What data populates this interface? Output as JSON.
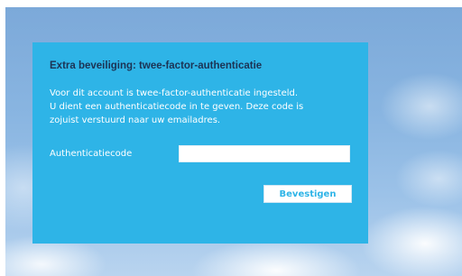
{
  "panel": {
    "title": "Extra beveiliging: twee-factor-authenticatie",
    "message_lines": [
      "Voor dit account is twee-factor-authenticatie ingesteld.",
      "U dient een authenticatiecode in te geven. Deze code is",
      "zojuist verstuurd naar uw emailadres."
    ],
    "code_label": "Authenticatiecode",
    "code_value": "",
    "confirm_label": "Bevestigen"
  },
  "colors": {
    "panel_background": "#2eb4e7",
    "title_text": "#1c3354",
    "button_text": "#2eb4e7"
  }
}
